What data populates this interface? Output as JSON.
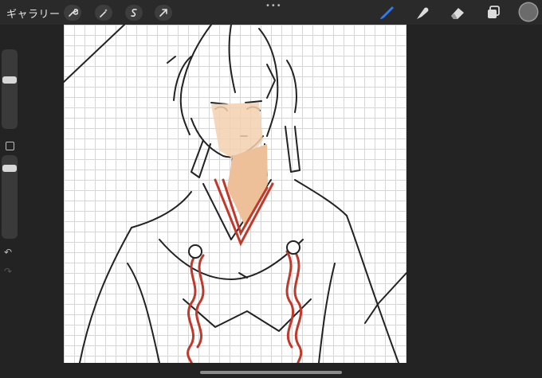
{
  "toolbar": {
    "gallery_label": "ギャラリー",
    "left_icons": [
      "wrench-icon",
      "magic-wand-icon",
      "selection-s-icon",
      "transform-arrow-icon"
    ],
    "right_icons": [
      "brush-icon",
      "smudge-icon",
      "eraser-icon",
      "layers-icon"
    ],
    "active_tool": "brush",
    "accent_color": "#2f7bf6",
    "current_color": "#6b6b6b"
  },
  "sidebar": {
    "brush_size_slider": "brush-size",
    "opacity_slider": "opacity",
    "undo_icon": "↶",
    "redo_icon": "↷"
  },
  "canvas": {
    "background": "grid-paper",
    "subject": "sketch"
  }
}
